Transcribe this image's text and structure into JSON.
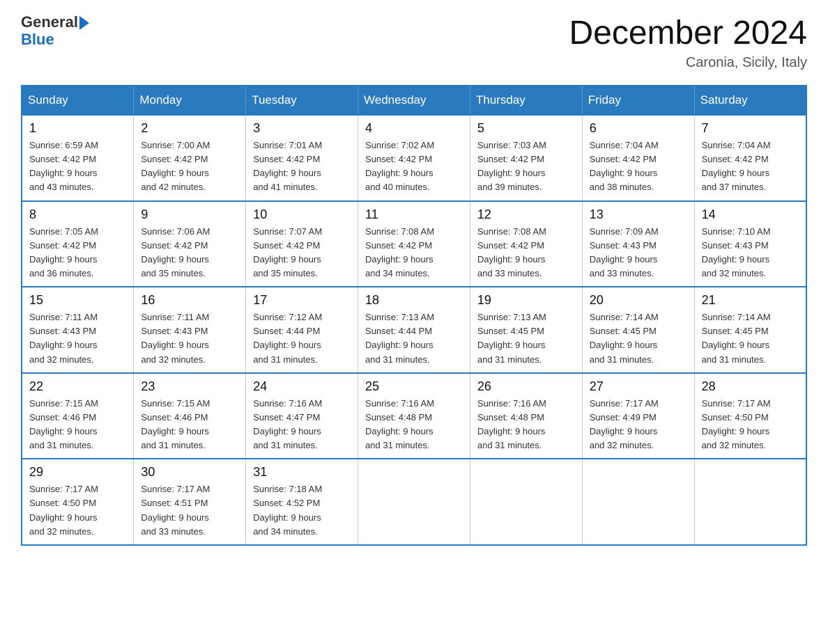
{
  "header": {
    "logo_general": "General",
    "logo_blue": "Blue",
    "month_title": "December 2024",
    "location": "Caronia, Sicily, Italy"
  },
  "days_of_week": [
    "Sunday",
    "Monday",
    "Tuesday",
    "Wednesday",
    "Thursday",
    "Friday",
    "Saturday"
  ],
  "weeks": [
    [
      {
        "day": "1",
        "sunrise": "6:59 AM",
        "sunset": "4:42 PM",
        "daylight": "9 hours and 43 minutes."
      },
      {
        "day": "2",
        "sunrise": "7:00 AM",
        "sunset": "4:42 PM",
        "daylight": "9 hours and 42 minutes."
      },
      {
        "day": "3",
        "sunrise": "7:01 AM",
        "sunset": "4:42 PM",
        "daylight": "9 hours and 41 minutes."
      },
      {
        "day": "4",
        "sunrise": "7:02 AM",
        "sunset": "4:42 PM",
        "daylight": "9 hours and 40 minutes."
      },
      {
        "day": "5",
        "sunrise": "7:03 AM",
        "sunset": "4:42 PM",
        "daylight": "9 hours and 39 minutes."
      },
      {
        "day": "6",
        "sunrise": "7:04 AM",
        "sunset": "4:42 PM",
        "daylight": "9 hours and 38 minutes."
      },
      {
        "day": "7",
        "sunrise": "7:04 AM",
        "sunset": "4:42 PM",
        "daylight": "9 hours and 37 minutes."
      }
    ],
    [
      {
        "day": "8",
        "sunrise": "7:05 AM",
        "sunset": "4:42 PM",
        "daylight": "9 hours and 36 minutes."
      },
      {
        "day": "9",
        "sunrise": "7:06 AM",
        "sunset": "4:42 PM",
        "daylight": "9 hours and 35 minutes."
      },
      {
        "day": "10",
        "sunrise": "7:07 AM",
        "sunset": "4:42 PM",
        "daylight": "9 hours and 35 minutes."
      },
      {
        "day": "11",
        "sunrise": "7:08 AM",
        "sunset": "4:42 PM",
        "daylight": "9 hours and 34 minutes."
      },
      {
        "day": "12",
        "sunrise": "7:08 AM",
        "sunset": "4:42 PM",
        "daylight": "9 hours and 33 minutes."
      },
      {
        "day": "13",
        "sunrise": "7:09 AM",
        "sunset": "4:43 PM",
        "daylight": "9 hours and 33 minutes."
      },
      {
        "day": "14",
        "sunrise": "7:10 AM",
        "sunset": "4:43 PM",
        "daylight": "9 hours and 32 minutes."
      }
    ],
    [
      {
        "day": "15",
        "sunrise": "7:11 AM",
        "sunset": "4:43 PM",
        "daylight": "9 hours and 32 minutes."
      },
      {
        "day": "16",
        "sunrise": "7:11 AM",
        "sunset": "4:43 PM",
        "daylight": "9 hours and 32 minutes."
      },
      {
        "day": "17",
        "sunrise": "7:12 AM",
        "sunset": "4:44 PM",
        "daylight": "9 hours and 31 minutes."
      },
      {
        "day": "18",
        "sunrise": "7:13 AM",
        "sunset": "4:44 PM",
        "daylight": "9 hours and 31 minutes."
      },
      {
        "day": "19",
        "sunrise": "7:13 AM",
        "sunset": "4:45 PM",
        "daylight": "9 hours and 31 minutes."
      },
      {
        "day": "20",
        "sunrise": "7:14 AM",
        "sunset": "4:45 PM",
        "daylight": "9 hours and 31 minutes."
      },
      {
        "day": "21",
        "sunrise": "7:14 AM",
        "sunset": "4:45 PM",
        "daylight": "9 hours and 31 minutes."
      }
    ],
    [
      {
        "day": "22",
        "sunrise": "7:15 AM",
        "sunset": "4:46 PM",
        "daylight": "9 hours and 31 minutes."
      },
      {
        "day": "23",
        "sunrise": "7:15 AM",
        "sunset": "4:46 PM",
        "daylight": "9 hours and 31 minutes."
      },
      {
        "day": "24",
        "sunrise": "7:16 AM",
        "sunset": "4:47 PM",
        "daylight": "9 hours and 31 minutes."
      },
      {
        "day": "25",
        "sunrise": "7:16 AM",
        "sunset": "4:48 PM",
        "daylight": "9 hours and 31 minutes."
      },
      {
        "day": "26",
        "sunrise": "7:16 AM",
        "sunset": "4:48 PM",
        "daylight": "9 hours and 31 minutes."
      },
      {
        "day": "27",
        "sunrise": "7:17 AM",
        "sunset": "4:49 PM",
        "daylight": "9 hours and 32 minutes."
      },
      {
        "day": "28",
        "sunrise": "7:17 AM",
        "sunset": "4:50 PM",
        "daylight": "9 hours and 32 minutes."
      }
    ],
    [
      {
        "day": "29",
        "sunrise": "7:17 AM",
        "sunset": "4:50 PM",
        "daylight": "9 hours and 32 minutes."
      },
      {
        "day": "30",
        "sunrise": "7:17 AM",
        "sunset": "4:51 PM",
        "daylight": "9 hours and 33 minutes."
      },
      {
        "day": "31",
        "sunrise": "7:18 AM",
        "sunset": "4:52 PM",
        "daylight": "9 hours and 34 minutes."
      },
      null,
      null,
      null,
      null
    ]
  ]
}
